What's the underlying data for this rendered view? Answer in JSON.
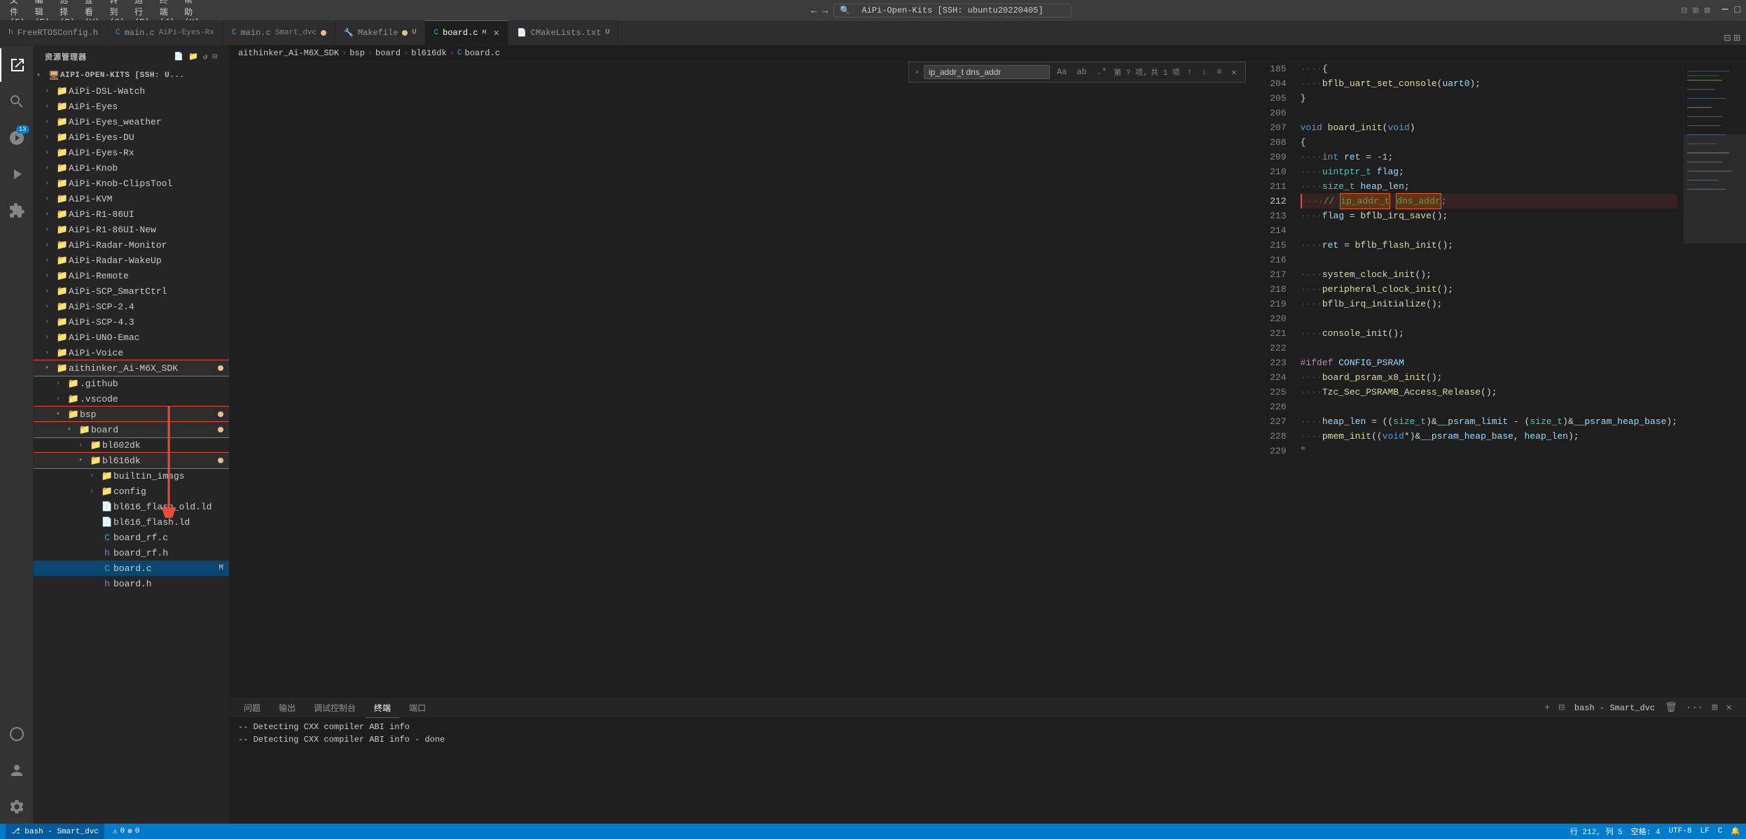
{
  "titleBar": {
    "menuItems": [
      "文件(F)",
      "编辑(E)",
      "选择(S)",
      "查看(V)",
      "转到(G)",
      "运行(R)",
      "终端(J)",
      "帮助(H)"
    ],
    "windowTitle": "AiPi-Open-Kits [SSH: ubuntu20220405]",
    "navBack": "←",
    "navForward": "→"
  },
  "tabs": [
    {
      "id": "tab-freertas",
      "icon": "h",
      "label": "FreeRTOSConfig.h",
      "iconColor": "#a074c4",
      "active": false,
      "modified": false
    },
    {
      "id": "tab-main-aipieyes",
      "icon": "c",
      "label": "main.c",
      "subtitle": "AiPi-Eyes-Rx",
      "iconColor": "#519aba",
      "active": false,
      "modified": false
    },
    {
      "id": "tab-main-smartdvc",
      "icon": "c",
      "label": "main.c",
      "subtitle": "Smart_dvc",
      "iconColor": "#519aba",
      "active": false,
      "dirty": true
    },
    {
      "id": "tab-makefile",
      "icon": "mk",
      "label": "Makefile",
      "iconColor": "#6d8086",
      "active": false,
      "dirty": true
    },
    {
      "id": "tab-board",
      "icon": "c",
      "label": "board.c",
      "iconColor": "#519aba",
      "active": true,
      "modified": true,
      "modifiedLabel": "M"
    },
    {
      "id": "tab-cmakelists",
      "icon": "cmake",
      "label": "CMakeLists.txt",
      "iconColor": "#6d8086",
      "active": false,
      "dirty": true
    }
  ],
  "breadcrumb": {
    "parts": [
      "aithinker_Ai-M6X_SDK",
      "bsp",
      "board",
      "bl616dk",
      "board.c"
    ]
  },
  "findBar": {
    "query": "ip_addr_t dns_addr",
    "options": [
      "Aa",
      "ab",
      ".*"
    ],
    "result": "第 ? 项，共 1 项",
    "navUp": "↑",
    "navDown": "↓",
    "listIcon": "≡",
    "close": "✕"
  },
  "sidebar": {
    "title": "资源管理器",
    "rootLabel": "AIPI-OPEN-KITS [SSH: U...",
    "items": [
      {
        "id": "AiPi-DSL-Watch",
        "label": "AiPi-DSL-Watch",
        "type": "folder",
        "depth": 1,
        "collapsed": true
      },
      {
        "id": "AiPi-Eyes",
        "label": "AiPi-Eyes",
        "type": "folder",
        "depth": 1,
        "collapsed": true
      },
      {
        "id": "AiPi-Eyes_weather",
        "label": "AiPi-Eyes_weather",
        "type": "folder",
        "depth": 1,
        "collapsed": true
      },
      {
        "id": "AiPi-Eyes-DU",
        "label": "AiPi-Eyes-DU",
        "type": "folder",
        "depth": 1,
        "collapsed": true
      },
      {
        "id": "AiPi-Eyes-Rx",
        "label": "AiPi-Eyes-Rx",
        "type": "folder",
        "depth": 1,
        "collapsed": true
      },
      {
        "id": "AiPi-Knob",
        "label": "AiPi-Knob",
        "type": "folder",
        "depth": 1,
        "collapsed": true
      },
      {
        "id": "AiPi-Knob-ClipsTool",
        "label": "AiPi-Knob-ClipsTool",
        "type": "folder",
        "depth": 1,
        "collapsed": true
      },
      {
        "id": "AiPi-KVM",
        "label": "AiPi-KVM",
        "type": "folder",
        "depth": 1,
        "collapsed": true
      },
      {
        "id": "AiPi-R1-86UI",
        "label": "AiPi-R1-86UI",
        "type": "folder",
        "depth": 1,
        "collapsed": true
      },
      {
        "id": "AiPi-R1-86UI-New",
        "label": "AiPi-R1-86UI-New",
        "type": "folder",
        "depth": 1,
        "collapsed": true
      },
      {
        "id": "AiPi-Radar-Monitor",
        "label": "AiPi-Radar-Monitor",
        "type": "folder",
        "depth": 1,
        "collapsed": true
      },
      {
        "id": "AiPi-Radar-WakeUp",
        "label": "AiPi-Radar-WakeUp",
        "type": "folder",
        "depth": 1,
        "collapsed": true
      },
      {
        "id": "AiPi-Remote",
        "label": "AiPi-Remote",
        "type": "folder",
        "depth": 1,
        "collapsed": true
      },
      {
        "id": "AiPi-SCP_SmartCtrl",
        "label": "AiPi-SCP_SmartCtrl",
        "type": "folder",
        "depth": 1,
        "collapsed": true
      },
      {
        "id": "AiPi-SCP-2.4",
        "label": "AiPi-SCP-2.4",
        "type": "folder",
        "depth": 1,
        "collapsed": true
      },
      {
        "id": "AiPi-SCP-4.3",
        "label": "AiPi-SCP-4.3",
        "type": "folder",
        "depth": 1,
        "collapsed": true
      },
      {
        "id": "AiPi-UNO-Emac",
        "label": "AiPi-UNO-Emac",
        "type": "folder",
        "depth": 1,
        "collapsed": true
      },
      {
        "id": "AiPi-Voice",
        "label": "AiPi-Voice",
        "type": "folder",
        "depth": 1,
        "collapsed": true
      },
      {
        "id": "aithinker_Ai-M6X_SDK",
        "label": "aithinker_Ai-M6X_SDK",
        "type": "folder",
        "depth": 1,
        "collapsed": false,
        "highlighted": true,
        "badge": true
      },
      {
        "id": ".github",
        "label": ".github",
        "type": "folder",
        "depth": 2,
        "collapsed": true
      },
      {
        "id": ".vscode",
        "label": ".vscode",
        "type": "folder",
        "depth": 2,
        "collapsed": true
      },
      {
        "id": "bsp",
        "label": "bsp",
        "type": "folder",
        "depth": 2,
        "collapsed": false,
        "highlighted": true,
        "badge": true
      },
      {
        "id": "board",
        "label": "board",
        "type": "folder",
        "depth": 3,
        "collapsed": false,
        "highlighted": true,
        "badge": true
      },
      {
        "id": "bl602dk",
        "label": "bl602dk",
        "type": "folder",
        "depth": 4,
        "collapsed": true
      },
      {
        "id": "bl616dk",
        "label": "bl616dk",
        "type": "folder",
        "depth": 4,
        "collapsed": false,
        "highlighted": true,
        "badge": true
      },
      {
        "id": "builtin_imags",
        "label": "builtin_imags",
        "type": "folder",
        "depth": 5,
        "collapsed": true
      },
      {
        "id": "config",
        "label": "config",
        "type": "folder",
        "depth": 5,
        "collapsed": true
      },
      {
        "id": "bl616_flash_old.ld",
        "label": "bl616_flash_old.ld",
        "type": "file",
        "depth": 5,
        "fileType": "ld"
      },
      {
        "id": "bl616_flash.ld",
        "label": "bl616_flash.ld",
        "type": "file",
        "depth": 5,
        "fileType": "ld"
      },
      {
        "id": "board_rf.c",
        "label": "board_rf.c",
        "type": "file",
        "depth": 5,
        "fileType": "c"
      },
      {
        "id": "board_rf.h",
        "label": "board_rf.h",
        "type": "file",
        "depth": 5,
        "fileType": "h"
      },
      {
        "id": "board.c",
        "label": "board.c",
        "type": "file",
        "depth": 5,
        "fileType": "c",
        "selected": true,
        "modified": "M"
      },
      {
        "id": "board.h",
        "label": "board.h",
        "type": "file",
        "depth": 5,
        "fileType": "h"
      }
    ]
  },
  "editor": {
    "lines": [
      {
        "num": 185,
        "code": "    {",
        "tokens": [
          {
            "t": "punct",
            "v": "    {"
          }
        ]
      },
      {
        "num": 204,
        "code": "    bflb_uart_set_console(uart0);",
        "tokens": []
      },
      {
        "num": 205,
        "code": "}",
        "tokens": []
      },
      {
        "num": 206,
        "code": "",
        "tokens": []
      },
      {
        "num": 207,
        "code": "void board_init(void)",
        "tokens": []
      },
      {
        "num": 208,
        "code": "{",
        "tokens": []
      },
      {
        "num": 209,
        "code": "    int ret = -1;",
        "tokens": []
      },
      {
        "num": 210,
        "code": "    uintptr_t flag;",
        "tokens": []
      },
      {
        "num": 211,
        "code": "    size_t heap_len;",
        "tokens": []
      },
      {
        "num": 212,
        "code": "    // ip_addr_t dns_addr;",
        "tokens": [],
        "isHighlighted": true
      },
      {
        "num": 213,
        "code": "    flag = bflb_irq_save();",
        "tokens": []
      },
      {
        "num": 214,
        "code": "",
        "tokens": []
      },
      {
        "num": 215,
        "code": "    ret = bflb_flash_init();",
        "tokens": []
      },
      {
        "num": 216,
        "code": "",
        "tokens": []
      },
      {
        "num": 217,
        "code": "    system_clock_init();",
        "tokens": []
      },
      {
        "num": 218,
        "code": "    peripheral_clock_init();",
        "tokens": []
      },
      {
        "num": 219,
        "code": "    bflb_irq_initialize();",
        "tokens": []
      },
      {
        "num": 220,
        "code": "",
        "tokens": []
      },
      {
        "num": 221,
        "code": "    console_init();",
        "tokens": []
      },
      {
        "num": 222,
        "code": "",
        "tokens": []
      },
      {
        "num": 223,
        "code": "#ifdef CONFIG_PSRAM",
        "tokens": []
      },
      {
        "num": 224,
        "code": "    board_psram_x8_init();",
        "tokens": []
      },
      {
        "num": 225,
        "code": "    Tzc_Sec_PSRAMB_Access_Release();",
        "tokens": []
      },
      {
        "num": 226,
        "code": "",
        "tokens": []
      },
      {
        "num": 227,
        "code": "    heap_len = ((size_t)&__psram_limit - (size_t)&__psram_heap_base);",
        "tokens": []
      },
      {
        "num": 228,
        "code": "    pmem_init((void*)&__psram_heap_base, heap_len);",
        "tokens": []
      },
      {
        "num": 229,
        "code": "\"",
        "tokens": []
      }
    ]
  },
  "bottomPanel": {
    "tabs": [
      "问题",
      "输出",
      "调试控制台",
      "终端",
      "端口"
    ],
    "activeTab": "终端",
    "terminalSessions": [
      {
        "label": "bash - Smart_dvc"
      }
    ],
    "lines": [
      "-- Detecting CXX compiler ABI info",
      "-- Detecting CXX compiler ABI info - done"
    ]
  },
  "statusBar": {
    "leftItems": [
      "⎇ bash - Smart_dvc"
    ],
    "rightItems": [
      "行 212, 列 5",
      "空格: 4",
      "UTF-8",
      "LF",
      "C",
      "⚡"
    ]
  },
  "activityBar": {
    "icons": [
      {
        "id": "explorer",
        "symbol": "⊞",
        "active": true
      },
      {
        "id": "search",
        "symbol": "🔍",
        "active": false
      },
      {
        "id": "git",
        "symbol": "⎇",
        "active": false,
        "badge": "13"
      },
      {
        "id": "debug",
        "symbol": "▷",
        "active": false
      },
      {
        "id": "extensions",
        "symbol": "⊟",
        "active": false
      },
      {
        "id": "remote",
        "symbol": "⊙",
        "active": false
      }
    ]
  }
}
